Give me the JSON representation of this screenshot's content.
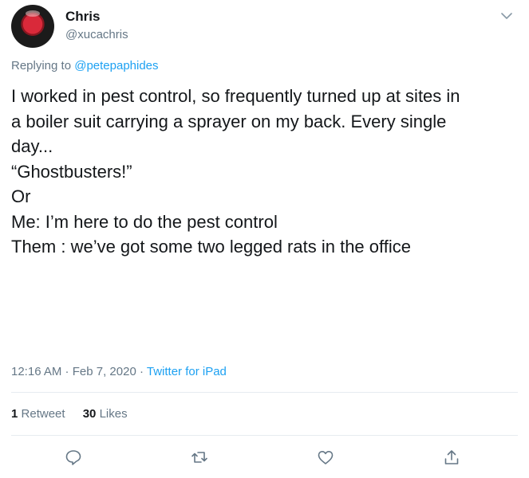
{
  "user": {
    "display_name": "Chris",
    "handle": "@xucachris",
    "avatar_icon": "record-avatar"
  },
  "reply": {
    "prefix": "Replying to",
    "mention": "@petepaphides"
  },
  "tweet": {
    "lines": [
      "I worked in pest control, so frequently turned up at sites in",
      "a boiler suit carrying a sprayer on my back. Every single",
      "day...",
      "",
      "“Ghostbusters!”",
      "",
      "Or",
      "",
      "Me: I’m here to do the pest control",
      "Them : we’ve got some two legged rats in the office"
    ]
  },
  "meta": {
    "time": "12:16 AM",
    "separator1": " · ",
    "date": "Feb 7, 2020",
    "separator2": " · ",
    "source": "Twitter for iPad"
  },
  "stats": {
    "retweet_count": "1",
    "retweet_label": "Retweet",
    "like_count": "30",
    "like_label": "Likes"
  },
  "actions": {
    "icons": [
      "reply-icon",
      "retweet-icon",
      "like-icon",
      "share-icon"
    ]
  },
  "colors": {
    "text": "#14171a",
    "secondary": "#657786",
    "link": "#1da1f2",
    "divider": "#e6ecf0"
  }
}
